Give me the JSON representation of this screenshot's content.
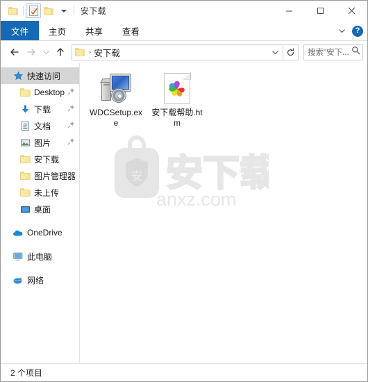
{
  "window": {
    "title": "安下载",
    "quick_access_toolbar": [
      {
        "name": "folder-icon",
        "label": "属性"
      },
      {
        "name": "properties-icon",
        "label": "属性",
        "active": true
      },
      {
        "name": "new-folder-icon",
        "label": "新建文件夹"
      },
      {
        "name": "customize-caret-icon",
        "label": "自定义快速访问工具栏"
      }
    ],
    "caption": {
      "minimize": "最小化",
      "maximize": "最大化",
      "close": "关闭"
    }
  },
  "ribbon": {
    "tabs": [
      {
        "label": "文件",
        "active": true
      },
      {
        "label": "主页",
        "active": false
      },
      {
        "label": "共享",
        "active": false
      },
      {
        "label": "查看",
        "active": false
      }
    ],
    "collapse_icon": "chevron-down-icon",
    "help_label": "?"
  },
  "navbar": {
    "back": "←",
    "forward": "→",
    "recent": "⌄",
    "up": "↑",
    "address": {
      "folder_icon": "folder-icon",
      "separator": "›",
      "path": "安下载",
      "caret": "⌄"
    },
    "refresh": "↻",
    "search": {
      "placeholder": "搜索\"安下...",
      "icon": "search-icon"
    }
  },
  "sidebar": {
    "items": [
      {
        "label": "快速访问",
        "icon": "star-icon",
        "selected": true,
        "pinned": false,
        "indent": 0
      },
      {
        "label": "Desktop",
        "icon": "folder-icon",
        "selected": false,
        "pinned": true,
        "indent": 1
      },
      {
        "label": "下载",
        "icon": "download-icon",
        "selected": false,
        "pinned": true,
        "indent": 1
      },
      {
        "label": "文档",
        "icon": "document-icon",
        "selected": false,
        "pinned": true,
        "indent": 1
      },
      {
        "label": "图片",
        "icon": "picture-icon",
        "selected": false,
        "pinned": true,
        "indent": 1
      },
      {
        "label": "安下载",
        "icon": "folder-icon",
        "selected": false,
        "pinned": false,
        "indent": 1
      },
      {
        "label": "图片管理器",
        "icon": "folder-icon",
        "selected": false,
        "pinned": false,
        "indent": 1
      },
      {
        "label": "未上传",
        "icon": "folder-icon",
        "selected": false,
        "pinned": false,
        "indent": 1
      },
      {
        "label": "桌面",
        "icon": "desktop-icon",
        "selected": false,
        "pinned": false,
        "indent": 1
      },
      {
        "label": "OneDrive",
        "icon": "cloud-icon",
        "selected": false,
        "pinned": false,
        "indent": 0,
        "spacer_before": true
      },
      {
        "label": "此电脑",
        "icon": "this-pc-icon",
        "selected": false,
        "pinned": false,
        "indent": 0,
        "spacer_before": true
      },
      {
        "label": "网络",
        "icon": "network-icon",
        "selected": false,
        "pinned": false,
        "indent": 0,
        "spacer_before": true
      }
    ]
  },
  "content": {
    "files": [
      {
        "name": "WDCSetup.exe",
        "icon": "exe-setup-icon"
      },
      {
        "name": "安下载帮助.htm",
        "icon": "html-document-icon"
      }
    ],
    "watermark": {
      "brand": "安下载",
      "site": "anxz.com",
      "shield_char": "安"
    }
  },
  "statusbar": {
    "item_count_text": "2 个项目"
  },
  "colors": {
    "accent": "#1669b4",
    "selection": "#d5d5d5",
    "folder": "#fce9a8",
    "text": "#1b1b1b",
    "watermark": "#e4e4e4"
  }
}
